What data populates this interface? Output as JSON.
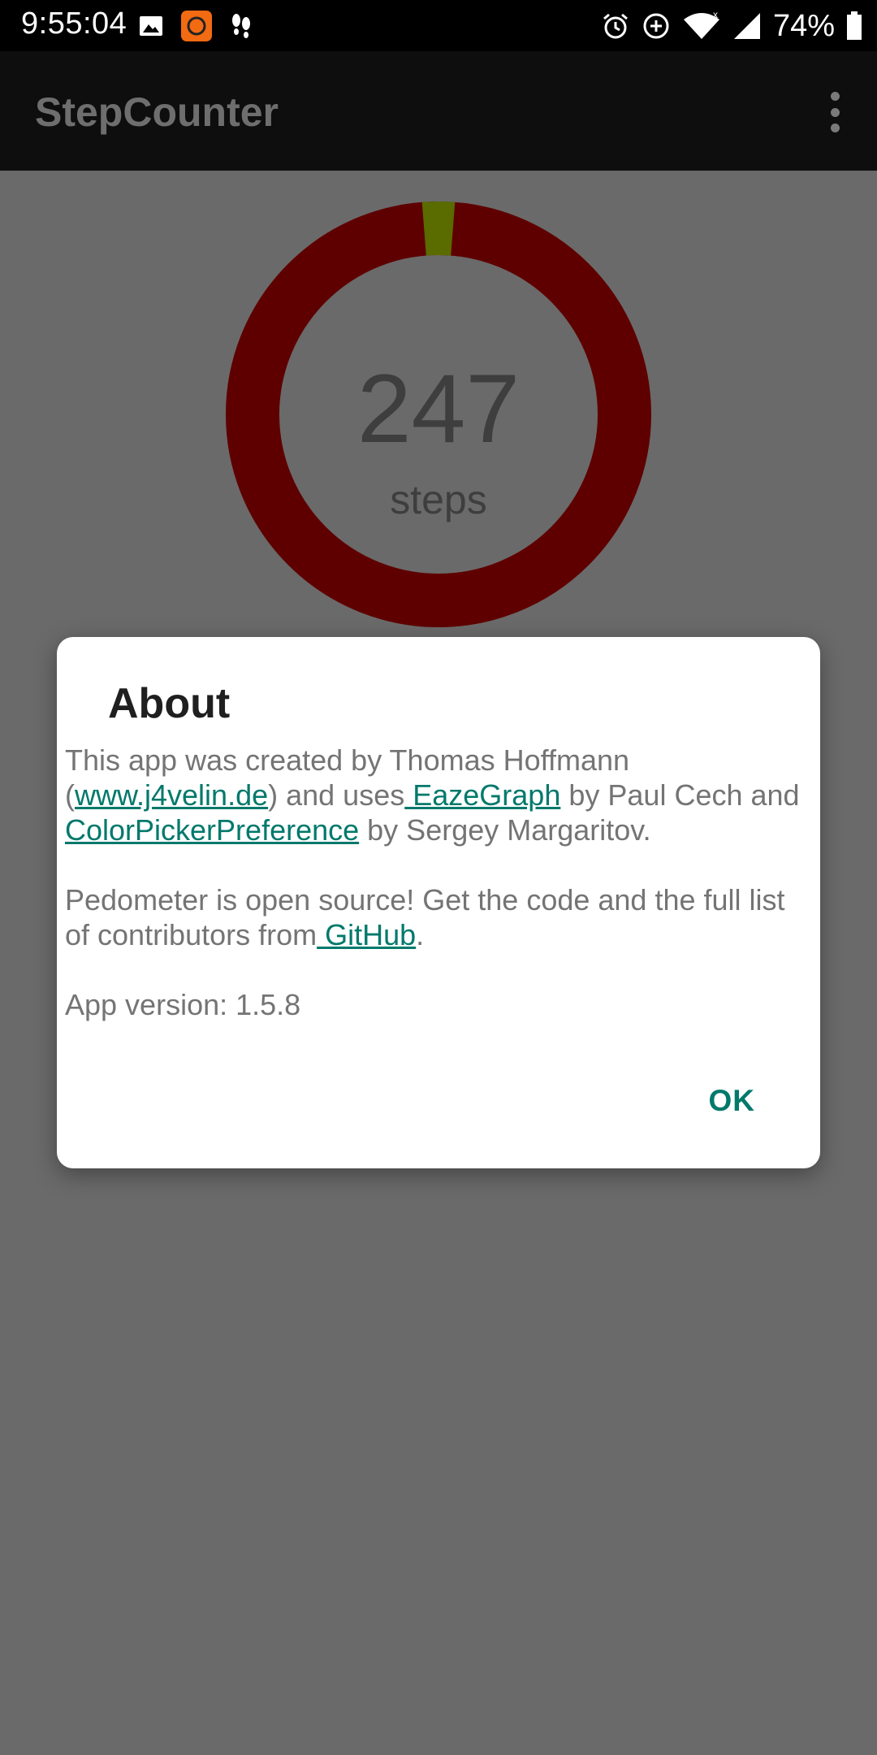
{
  "status_bar": {
    "time": "9:55:04",
    "battery": "74%",
    "icons": [
      "image-icon",
      "app-notification-icon",
      "footsteps-icon",
      "alarm-icon",
      "data-saver-icon",
      "wifi-icon",
      "signal-icon",
      "battery-icon"
    ]
  },
  "app_bar": {
    "title": "StepCounter",
    "menu_icon": "overflow-menu-icon"
  },
  "progress": {
    "steps": "247",
    "label": "steps",
    "goal_fraction": 0.0247,
    "ring_color": "#5f0000",
    "progress_color": "#5a6b00"
  },
  "dialog": {
    "title": "About",
    "para1": {
      "text1": "This app was created by Thomas Hoffmann (",
      "link1": "www.j4velin.de",
      "text2": ") and uses",
      "link2": " EazeGraph",
      "text3": " by Paul Cech and ",
      "link3": "ColorPickerPreference",
      "text4": " by Sergey Margaritov."
    },
    "para2": {
      "text1": "Pedometer is open source! Get the code and the full list of contributors from",
      "link1": " GitHub",
      "text2": "."
    },
    "version": "App version: 1.5.8",
    "ok_label": "OK",
    "accent_color": "#00796b"
  }
}
